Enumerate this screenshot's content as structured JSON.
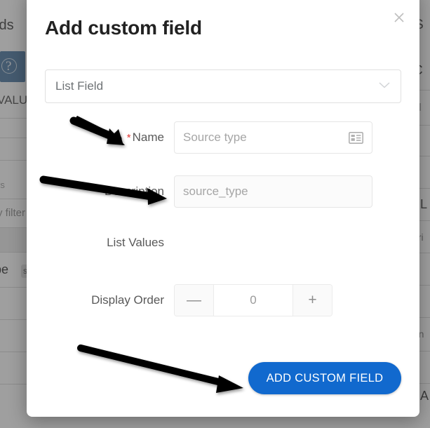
{
  "modal": {
    "title": "Add custom field",
    "close_icon": "close-icon",
    "type_select": {
      "value": "List Field",
      "chevron_icon": "chevron-down-icon"
    },
    "fields": [
      {
        "label": "Name",
        "required_marker": "*",
        "required": true,
        "placeholder": "Source type",
        "trailing_icon": "contact-card-icon"
      },
      {
        "label": "Description",
        "required_marker": "",
        "required": false,
        "placeholder": "source_type",
        "trailing_icon": ""
      }
    ],
    "list_values_label": "List Values",
    "display_order": {
      "label": "Display Order",
      "value": "0",
      "decrement_label": "—",
      "increment_label": "+"
    },
    "submit_label": "ADD CUSTOM FIELD",
    "accent_color": "#1169CE",
    "required_color": "#e23a36"
  },
  "annotations": {
    "arrow_count": 3,
    "arrow_color": "#000000",
    "targets": [
      "Name",
      "Description",
      "ADD CUSTOM FIELD"
    ]
  },
  "background": {
    "left": {
      "page_heading_fragment": "lds",
      "values_header_fragment": "VALU",
      "help_icon": "question-mark-icon",
      "filters_fragment": "rs",
      "any_filter_fragment": "y filter",
      "row_text_fragment": "pe",
      "chip_fragment": "s"
    },
    "right": {
      "fragments": [
        "S",
        "C",
        "el",
        "L",
        "stri",
        "trin",
        "A"
      ]
    }
  }
}
